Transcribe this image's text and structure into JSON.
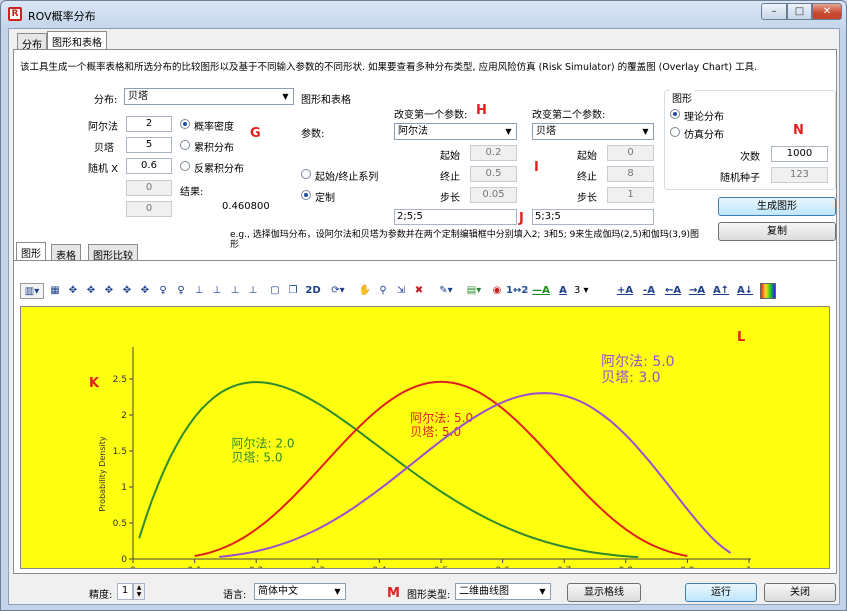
{
  "window": {
    "title": "ROV概率分布",
    "min": "–",
    "max": "□",
    "close": "✕"
  },
  "tabs_top": [
    "分布",
    "图形和表格"
  ],
  "description": "该工具生成一个概率表格和所选分布的比较图形以及基于不同输入参数的不同形状. 如果要查看多种分布类型, 应用风险仿真 (Risk Simulator) 的覆盖图 (Overlay Chart) 工具.",
  "dist": {
    "label": "分布:",
    "value": "贝塔"
  },
  "params": [
    {
      "label": "阿尔法",
      "value": "2"
    },
    {
      "label": "贝塔",
      "value": "5"
    },
    {
      "label": "随机 X",
      "value": "0.6"
    }
  ],
  "blank_boxes": [
    "0",
    "0"
  ],
  "modes": [
    "概率密度",
    "累积分布",
    "反累积分布"
  ],
  "result": {
    "label": "结果:",
    "value": "0.460800"
  },
  "chart_table": {
    "title": "图形和表格",
    "params_label": "参数:",
    "options": [
      "起始/终止系列",
      "定制"
    ]
  },
  "var1": {
    "title": "改变第一个参数:",
    "value": "阿尔法",
    "start_label": "起始",
    "start": "0.2",
    "end_label": "终止",
    "end": "0.5",
    "step_label": "步长",
    "step": "0.05",
    "custom": "2;5;5"
  },
  "var2": {
    "title": "改变第二个参数:",
    "value": "贝塔",
    "start_label": "起始",
    "start": "0",
    "end_label": "终止",
    "end": "8",
    "step_label": "步长",
    "step": "1",
    "custom": "5;3;5"
  },
  "graph": {
    "title": "图形",
    "options": [
      "理论分布",
      "仿真分布"
    ],
    "runs_label": "次数",
    "runs": "1000",
    "seed_label": "随机种子",
    "seed": "123"
  },
  "buttons": {
    "generate": "生成图形",
    "copy": "复制",
    "gridlines": "显示格线",
    "run": "运行",
    "close": "关闭"
  },
  "example": "e.g., 选择伽玛分布，设阿尔法和贝塔为参数并在两个定制编辑框中分别填入2; 3和5; 9来生成伽玛(2,5)和伽玛(3,9)图形",
  "tabs_bottom": [
    "图形",
    "表格",
    "图形比较"
  ],
  "toolbar_text": [
    "2D",
    "3"
  ],
  "annotations": [
    "H",
    "G",
    "I",
    "J",
    "N",
    "K",
    "L",
    "M"
  ],
  "footer": {
    "precision_label": "精度:",
    "precision": "1",
    "language_label": "语言:",
    "language": "简体中文",
    "chart_type_label": "图形类型:",
    "chart_type": "二维曲线图"
  },
  "colors": {
    "green": "#2e8b2e",
    "red": "#e02020",
    "purple": "#9b4fd0",
    "yellow": "#ffff10"
  },
  "chart_data": {
    "type": "line",
    "ylabel": "Probability Density",
    "xlim": [
      0,
      1
    ],
    "ylim": [
      0,
      2.5
    ],
    "x_ticks": [
      "0",
      "0.1",
      "0.2",
      "0.3",
      "0.4",
      "0.5",
      "0.6",
      "0.7",
      "0.8",
      "0.9",
      "1"
    ],
    "y_ticks": [
      "0",
      "0.5",
      "1",
      "1.5",
      "2",
      "2.5"
    ],
    "series": [
      {
        "alpha": 2,
        "beta": 5,
        "annotation": [
          "阿尔法: 2.0",
          "贝塔: 5.0"
        ],
        "color": "#2e8b2e",
        "x_start": 0.01,
        "x_end": 0.82
      },
      {
        "alpha": 5,
        "beta": 5,
        "annotation": [
          "阿尔法: 5.0",
          "贝塔: 5.0"
        ],
        "color": "#e02020",
        "x_start": 0.1,
        "x_end": 0.9
      },
      {
        "alpha": 5,
        "beta": 3,
        "annotation": [
          "阿尔法: 5.0",
          "贝塔: 3.0"
        ],
        "color": "#9b4fd0",
        "x_start": 0.14,
        "x_end": 0.97
      }
    ]
  }
}
